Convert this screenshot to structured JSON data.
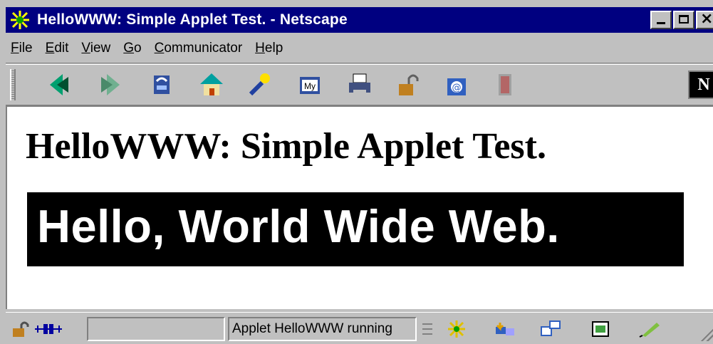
{
  "window": {
    "title": "HelloWWW: Simple Applet Test. - Netscape",
    "controls": [
      "minimize",
      "maximize",
      "close"
    ]
  },
  "menu": [
    {
      "label": "File",
      "key": "F",
      "rest": "ile"
    },
    {
      "label": "Edit",
      "key": "E",
      "rest": "dit"
    },
    {
      "label": "View",
      "key": "V",
      "rest": "iew"
    },
    {
      "label": "Go",
      "key": "G",
      "rest": "o"
    },
    {
      "label": "Communicator",
      "key": "C",
      "rest": "ommunicator"
    },
    {
      "label": "Help",
      "key": "H",
      "rest": "elp"
    }
  ],
  "toolbar": {
    "buttons": [
      "back-icon",
      "forward-icon",
      "reload-icon",
      "home-icon",
      "search-icon",
      "my-netscape-icon",
      "print-icon",
      "security-icon",
      "shop-icon",
      "stop-icon"
    ],
    "my_label": "My",
    "logo": "N"
  },
  "page": {
    "heading": "HelloWWW: Simple Applet Test.",
    "applet_text": "Hello, World Wide Web."
  },
  "status": {
    "text": "Applet HelloWWW running"
  },
  "colors": {
    "titlebar": "#000080",
    "chrome": "#c0c0c0",
    "applet_bg": "#000000",
    "applet_fg": "#ffffff"
  }
}
